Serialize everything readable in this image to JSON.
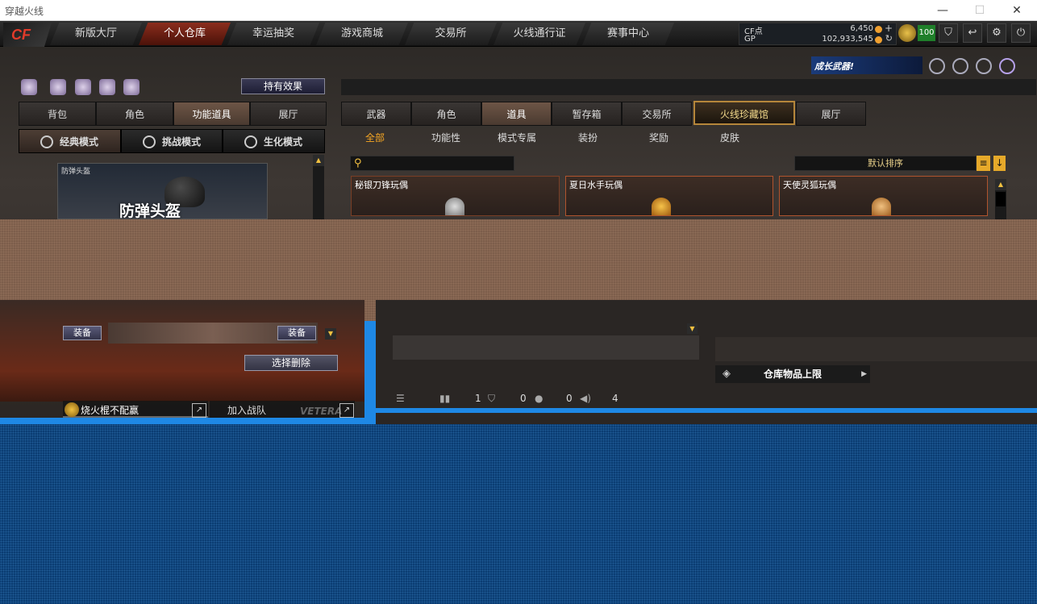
{
  "window": {
    "title": "穿越火线",
    "min": "—",
    "max": "☐",
    "close": "✕"
  },
  "nav": {
    "logo": "CF",
    "tabs": [
      "新版大厅",
      "个人仓库",
      "幸运抽奖",
      "游戏商城",
      "交易所",
      "火线通行证",
      "赛事中心"
    ],
    "active_index": 1
  },
  "currency": {
    "cf_label": "CF点",
    "cf_value": "6,450",
    "gp_label": "GP",
    "gp_value": "102,933,545",
    "plus": "+",
    "refresh": "↻"
  },
  "player": {
    "level": "100"
  },
  "banner": {
    "text": "成长武器!"
  },
  "left": {
    "effect_button": "持有效果",
    "tabs": [
      "背包",
      "角色",
      "功能道具",
      "展厅"
    ],
    "active_tab": 2,
    "modes": [
      "经典模式",
      "挑战模式",
      "生化模式"
    ],
    "active_mode": 0,
    "preview": {
      "caption": "防弹头盔",
      "title": "防弹头盔"
    },
    "equip_label": "装备",
    "delete_button": "选择删除",
    "clan_name": "烧火棍不配赢",
    "join_clan": "加入战队",
    "veteran": "VETERA"
  },
  "right": {
    "tabs": [
      "武器",
      "角色",
      "道具",
      "暂存箱",
      "交易所",
      "火线珍藏馆",
      "展厅"
    ],
    "active_tab": 2,
    "special_tab": 5,
    "subtabs": [
      "全部",
      "功能性",
      "模式专属",
      "装扮",
      "奖励",
      "皮肤"
    ],
    "active_subtab": 0,
    "search_placeholder": "",
    "sort_label": "默认排序",
    "items": [
      "秘银刀锋玩偶",
      "夏日水手玩偶",
      "天使灵狐玩偶"
    ],
    "warehouse_limit": "仓库物品上限",
    "status": {
      "items": "1",
      "shield": "0",
      "chat": "0",
      "sound": "4"
    }
  }
}
